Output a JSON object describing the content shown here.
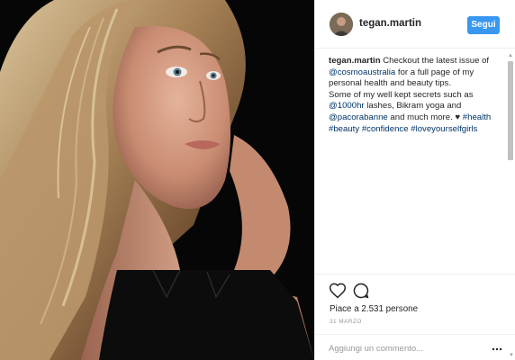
{
  "post": {
    "photo_alt": "photo",
    "author": {
      "username": "tegan.martin",
      "follow_label": "Segui"
    },
    "caption": {
      "author": "tegan.martin",
      "t1": " Checkout the latest issue of ",
      "tag1": "@cosmoaustralia",
      "t2": " for a full page of my personal health and beauty tips.",
      "t3": "Some of my well kept secrets such as ",
      "tag2": "@1000hr",
      "t4": " lashes, Bikram yoga and ",
      "tag3": "@pacorabanne",
      "t5": " and much more. ",
      "heart": "♥",
      "tag4": "#health",
      "tag5": "#beauty",
      "tag6": "#confidence",
      "tag7": "#loveyourselfgirls"
    },
    "likes_text": "Piace a 2.531 persone",
    "date_text": "31 MARZO",
    "comment_placeholder": "Aggiungi un commento...",
    "icons": {
      "like": "heart-outline-icon",
      "comment": "comment-bubble-icon",
      "more": "more-dots-icon"
    },
    "colors": {
      "follow_button": "#3897f0",
      "link": "#003569",
      "text": "#262626",
      "muted": "#999999"
    }
  }
}
